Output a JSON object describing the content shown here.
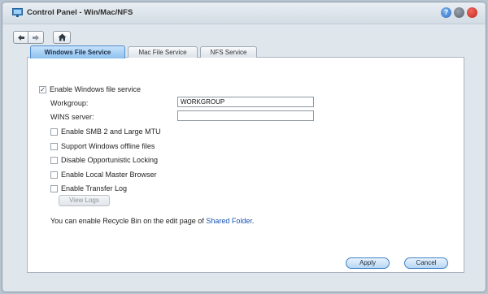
{
  "window": {
    "title": "Control Panel - Win/Mac/NFS",
    "help": "?"
  },
  "tabs": [
    {
      "label": "Windows File Service",
      "active": true
    },
    {
      "label": "Mac File Service",
      "active": false
    },
    {
      "label": "NFS Service",
      "active": false
    }
  ],
  "form": {
    "enable_windows": {
      "label": "Enable Windows file service",
      "checked": true
    },
    "workgroup": {
      "label": "Workgroup:",
      "value": "WORKGROUP"
    },
    "wins": {
      "label": "WINS server:",
      "value": ""
    },
    "options": [
      {
        "label": "Enable SMB 2 and Large MTU",
        "checked": false
      },
      {
        "label": "Support Windows offline files",
        "checked": false
      },
      {
        "label": "Disable Opportunistic Locking",
        "checked": false
      },
      {
        "label": "Enable Local Master Browser",
        "checked": false
      },
      {
        "label": "Enable Transfer Log",
        "checked": false
      }
    ],
    "view_logs": "View Logs",
    "note_prefix": "You can enable Recycle Bin on the edit page of ",
    "note_link": "Shared Folder",
    "note_suffix": "."
  },
  "buttons": {
    "apply": "Apply",
    "cancel": "Cancel"
  },
  "icons": {
    "app": "control-panel-icon",
    "back": "arrow-left-icon",
    "forward": "arrow-right-icon",
    "home": "home-icon"
  }
}
